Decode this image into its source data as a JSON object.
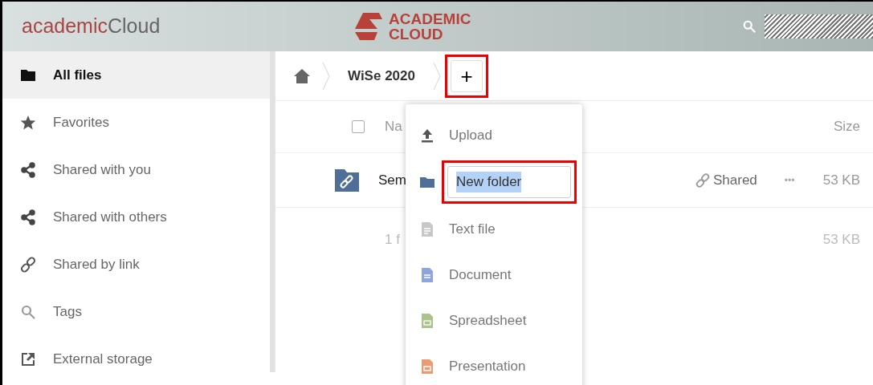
{
  "header": {
    "brand": {
      "part_1": "academic",
      "part_2": "Cloud"
    },
    "logo": {
      "line_1": "ACADEMIC",
      "line_2": "CLOUD"
    }
  },
  "sidebar": {
    "items": [
      {
        "label": "All files",
        "kind": "folder",
        "selected": true
      },
      {
        "label": "Favorites",
        "kind": "star",
        "selected": false
      },
      {
        "label": "Shared with you",
        "kind": "share",
        "selected": false
      },
      {
        "label": "Shared with others",
        "kind": "share",
        "selected": false
      },
      {
        "label": "Shared by link",
        "kind": "link",
        "selected": false
      },
      {
        "label": "Tags",
        "kind": "search",
        "selected": false
      },
      {
        "label": "External storage",
        "kind": "external",
        "selected": false
      }
    ]
  },
  "breadcrumb": {
    "items": [
      "WiSe 2020"
    ],
    "add_button": {
      "label": "+",
      "annotated": true
    }
  },
  "table": {
    "select_all": {
      "checked": false
    },
    "columns": [
      "Na",
      "Size"
    ],
    "rows": [
      {
        "name": "Sem",
        "share": "Shared",
        "actions": "•••",
        "size": "53 KB"
      }
    ],
    "summary": {
      "text": "1 f",
      "size": "53 KB"
    }
  },
  "new_menu": {
    "items": [
      {
        "kind": "upload",
        "label": "Upload"
      },
      {
        "kind": "folder",
        "value": "New folder",
        "annotated": true
      },
      {
        "kind": "text",
        "label": "Text file"
      },
      {
        "kind": "document",
        "label": "Document"
      },
      {
        "kind": "spreadsheet",
        "label": "Spreadsheet"
      },
      {
        "kind": "presentation",
        "label": "Presentation"
      }
    ]
  }
}
